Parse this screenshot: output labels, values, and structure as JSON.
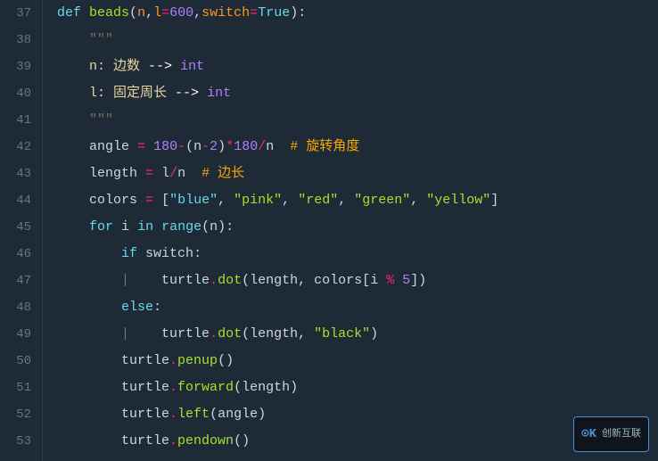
{
  "editor": {
    "background": "#1e2a35",
    "lines": [
      {
        "number": 37,
        "content": "def_beads"
      },
      {
        "number": 38,
        "content": "docstr_open"
      },
      {
        "number": 39,
        "content": "n_doc"
      },
      {
        "number": 40,
        "content": "l_doc"
      },
      {
        "number": 41,
        "content": "docstr_close"
      },
      {
        "number": 42,
        "content": "angle_line"
      },
      {
        "number": 43,
        "content": "length_line"
      },
      {
        "number": 44,
        "content": "colors_line"
      },
      {
        "number": 45,
        "content": "for_line"
      },
      {
        "number": 46,
        "content": "if_line"
      },
      {
        "number": 47,
        "content": "turtle_dot_colors"
      },
      {
        "number": 48,
        "content": "else_line"
      },
      {
        "number": 49,
        "content": "turtle_dot_black"
      },
      {
        "number": 50,
        "content": "turtle_penup"
      },
      {
        "number": 51,
        "content": "turtle_forward"
      },
      {
        "number": 52,
        "content": "turtle_left"
      },
      {
        "number": 53,
        "content": "turtle_pendown"
      }
    ]
  },
  "watermark": {
    "icon": "K",
    "text": "创新互联"
  }
}
